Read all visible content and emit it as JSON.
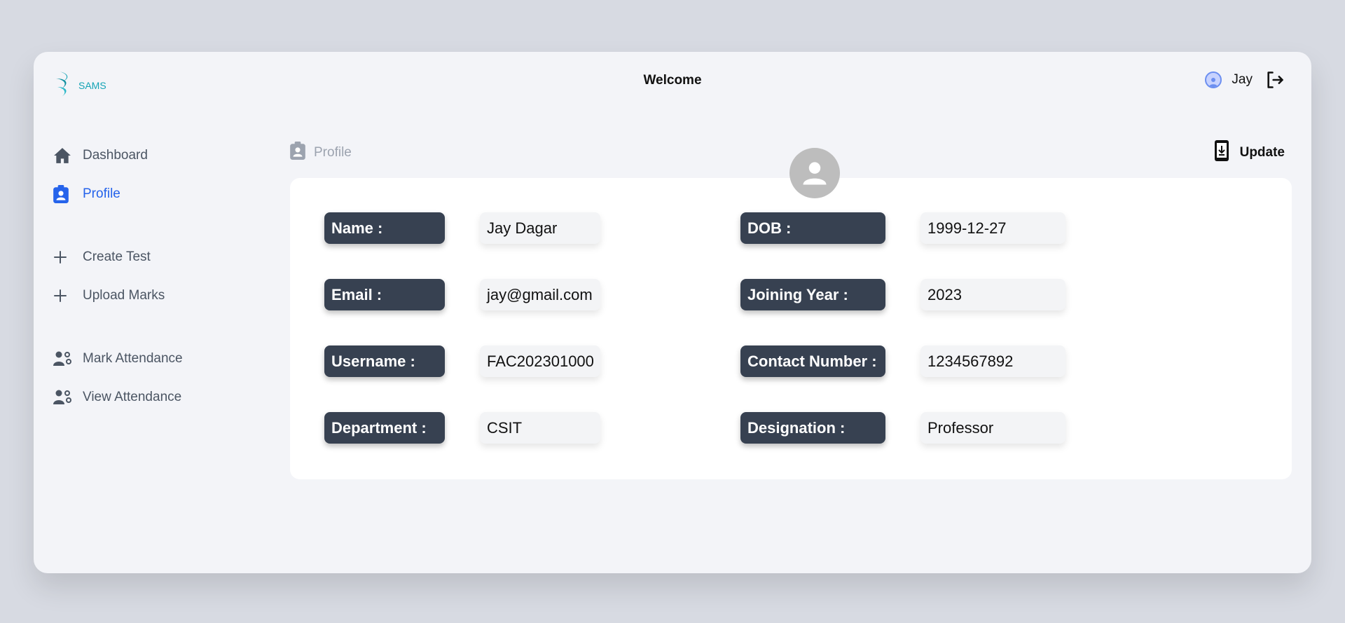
{
  "header": {
    "logo_text": "SAMS",
    "title": "Welcome",
    "user_name": "Jay"
  },
  "sidebar": {
    "items": [
      {
        "label": "Dashboard",
        "icon": "home-icon"
      },
      {
        "label": "Profile",
        "icon": "profile-badge-icon",
        "active": true
      },
      {
        "label": "Create Test",
        "icon": "plus-icon"
      },
      {
        "label": "Upload Marks",
        "icon": "plus-icon"
      },
      {
        "label": "Mark Attendance",
        "icon": "users-gear-icon"
      },
      {
        "label": "View Attendance",
        "icon": "users-gear-icon"
      }
    ]
  },
  "breadcrumb": {
    "label": "Profile",
    "icon": "profile-badge-icon"
  },
  "update_button": {
    "label": "Update",
    "icon": "phone-download-icon"
  },
  "profile": {
    "left": [
      {
        "label": "Name :",
        "value": "Jay Dagar"
      },
      {
        "label": "Email :",
        "value": "jay@gmail.com"
      },
      {
        "label": "Username :",
        "value": "FAC202301000"
      },
      {
        "label": "Department :",
        "value": "CSIT"
      }
    ],
    "right": [
      {
        "label": "DOB :",
        "value": "1999-12-27"
      },
      {
        "label": "Joining Year :",
        "value": "2023"
      },
      {
        "label": "Contact Number :",
        "value": "1234567892"
      },
      {
        "label": "Designation :",
        "value": "Professor"
      }
    ]
  },
  "colors": {
    "accent": "#2563eb",
    "label_bg": "#374151",
    "logo": "#14a3b5"
  }
}
